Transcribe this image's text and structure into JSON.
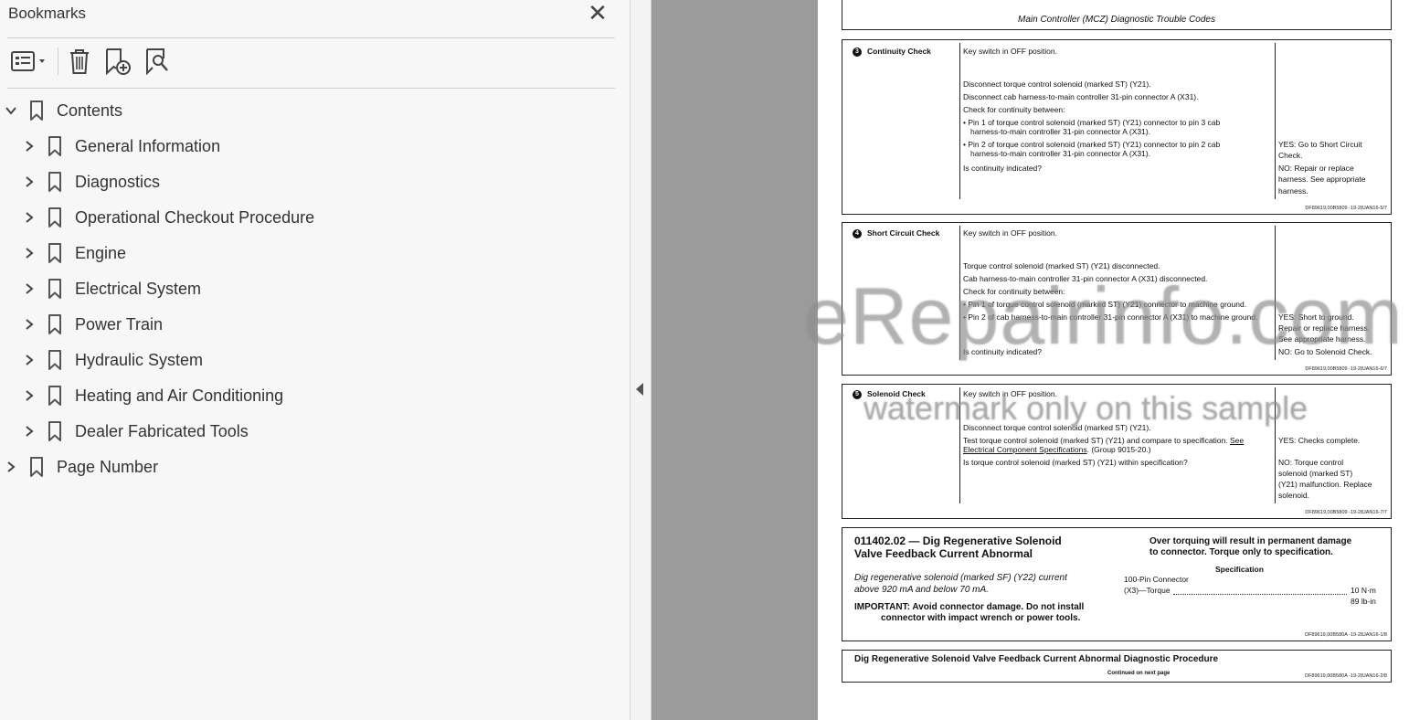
{
  "panel": {
    "title": "Bookmarks",
    "items": [
      {
        "label": "Contents",
        "level": 0
      },
      {
        "label": "General Information",
        "level": 1
      },
      {
        "label": "Diagnostics",
        "level": 1
      },
      {
        "label": "Operational Checkout Procedure",
        "level": 1
      },
      {
        "label": "Engine",
        "level": 1
      },
      {
        "label": "Electrical System",
        "level": 1
      },
      {
        "label": "Power Train",
        "level": 1
      },
      {
        "label": "Hydraulic System",
        "level": 1
      },
      {
        "label": "Heating and Air Conditioning",
        "level": 1
      },
      {
        "label": "Dealer Fabricated Tools",
        "level": 1
      },
      {
        "label": "Page Number",
        "level": 0
      }
    ]
  },
  "doc": {
    "header": "Main Controller (MCZ) Diagnostic Trouble Codes",
    "step3": {
      "num": "3",
      "title": "Continuity Check",
      "l1": "Key switch in OFF position.",
      "l2": "Disconnect torque control solenoid (marked ST) (Y21).",
      "l3": "Disconnect cab harness-to-main controller 31-pin connector A (X31).",
      "l4": "Check for continuity between:",
      "b1a": "• Pin 1 of torque control solenoid (marked ST) (Y21) connector to pin 3 cab",
      "b1b": "harness-to-main controller 31-pin connector A (X31).",
      "b2a": "• Pin 2 of torque control solenoid (marked ST) (Y21) connector to pin 2 cab",
      "b2b": "harness-to-main controller 31-pin connector A (X31).",
      "l5": "Is continuity indicated?",
      "yes1": "YES:  Go to Short Circuit",
      "yes2": "Check.",
      "no1": "NO:  Repair or replace",
      "no2": "harness.  See appropriate",
      "no3": "harness.",
      "ref": "DF89619,00B5809 -19-28JAN16-5/7"
    },
    "step4": {
      "num": "4",
      "title": "Short Circuit Check",
      "l1": "Key switch in OFF position.",
      "l2": "Torque control solenoid (marked ST) (Y21) disconnected.",
      "l3": "Cab harness-to-main controller 31-pin connector A (X31) disconnected.",
      "l4": "Check for continuity between:",
      "b1": "• Pin 1 of torque control solenoid (marked ST) (Y21) connector to machine ground.",
      "b2": "• Pin 2 of cab harness-to-main controller 31-pin connector A (X31) to machine ground.",
      "l5": "Is continuity indicated?",
      "yes1": "YES:  Short to ground.",
      "yes2": "Repair or replace harness.",
      "yes3": "See appropriate harness.",
      "no1": "NO:  Go to Solenoid Check.",
      "ref": "DF89619,00B5809 -19-28JAN16-6/7"
    },
    "step5": {
      "num": "5",
      "title": "Solenoid Check",
      "l1": "Key switch in OFF position.",
      "l2": "Disconnect torque control solenoid (marked ST) (Y21).",
      "l3a": "Test torque control solenoid (marked ST) (Y21) and compare to specification.",
      "l3link1": "See",
      "l3link2": "Electrical Component Specifications",
      "l3b": ". (Group 9015-20.)",
      "l4": "Is torque control solenoid (marked ST) (Y21) within specification?",
      "yes1": "YES:  Checks complete.",
      "no1": "NO:  Torque control",
      "no2": "solenoid (marked ST)",
      "no3": "(Y21) malfunction. Replace",
      "no4": "solenoid.",
      "ref": "DF89619,00B5809 -19-28JAN16-7/7"
    },
    "dtc": {
      "title1": "011402.02 — Dig Regenerative Solenoid",
      "title2": "Valve Feedback Current Abnormal",
      "desc1": "Dig regenerative solenoid (marked SF) (Y22) current",
      "desc2": "above 920 mA and below 70 mA.",
      "imp1": "IMPORTANT: Avoid connector damage. Do not install",
      "imp2": "connector with impact wrench or power tools.",
      "warn1": "Over torquing will result in permanent damage",
      "warn2": "to connector. Torque only to specification.",
      "spec_title": "Specification",
      "spec_l1": "100-Pin Connector",
      "spec_l2": "(X3)—Torque",
      "spec_v1": "10 N·m",
      "spec_v2": "89  lb-in",
      "ref": "DF89619,00B580A -19-28JAN16-1/8"
    },
    "procedure": {
      "title": "Dig Regenerative Solenoid Valve Feedback Current Abnormal Diagnostic Procedure",
      "continued": "Continued on next page",
      "ref": "DF89619,00B580A -19-28JAN16-2/8"
    }
  },
  "watermark": {
    "line1": "eRepairinfo.com",
    "line2": "watermark only on this sample"
  }
}
